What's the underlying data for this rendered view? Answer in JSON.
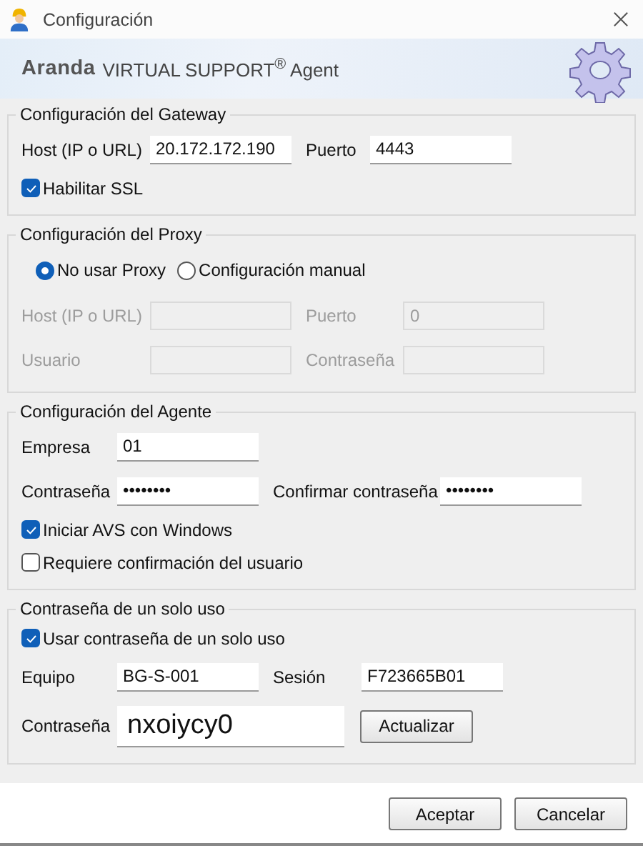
{
  "window": {
    "title": "Configuración"
  },
  "banner": {
    "brand": "Aranda",
    "product": "VIRTUAL SUPPORT$^{®}$ Agent"
  },
  "gateway": {
    "title": "Configuración del Gateway",
    "fields": [
      {
        "label": "Host (IP o URL)",
        "value": "20.172.172.190",
        "disabled": false
      },
      {
        "label": "Puerto",
        "value": "4443",
        "disabled": false
      }
    ],
    "checkboxes": [
      {
        "label": "Habilitar SSL",
        "checked": true
      }
    ]
  },
  "proxy": {
    "title": "Configuración del Proxy",
    "radios": [
      {
        "label": "No usar Proxy",
        "selected": true
      },
      {
        "label": "Configuración manual",
        "selected": false
      }
    ],
    "rows": [
      [
        {
          "label": "Host (IP o URL)",
          "disabled": true
        },
        {
          "label": "Puerto",
          "value": "0",
          "disabled": true
        }
      ],
      [
        {
          "label": "Usuario",
          "disabled": true
        },
        {
          "label": "Contraseña",
          "disabled": true
        }
      ]
    ]
  },
  "agent": {
    "title": "Configuración del Agente",
    "rows": [
      [
        {
          "label": "Empresa",
          "value": "01",
          "disabled": false
        }
      ],
      [
        {
          "label": "Contraseña",
          "value": "••••••••",
          "disabled": false
        },
        {
          "label": "Confirmar contraseña",
          "value": "••••••••",
          "disabled": false
        }
      ]
    ],
    "checkboxes": [
      {
        "label": "Iniciar AVS con Windows",
        "checked": true
      },
      {
        "label": "Requiere confirmación del usuario",
        "checked": false
      }
    ]
  },
  "one_time_password": {
    "title": "Contraseña de un solo uso",
    "checkboxes": [
      {
        "label": "Usar contraseña de un solo uso",
        "checked": true
      }
    ],
    "fields": [
      {
        "label": "Equipo",
        "value": "BG-S-001",
        "disabled": false
      },
      {
        "label": "Sesión",
        "value": "F723665B01",
        "disabled": false
      }
    ],
    "password": {
      "label": "Contraseña",
      "value": "nxoiycy0"
    },
    "refresh_button": "Actualizar"
  },
  "buttons": [
    "Aceptar",
    "Cancelar"
  ]
}
